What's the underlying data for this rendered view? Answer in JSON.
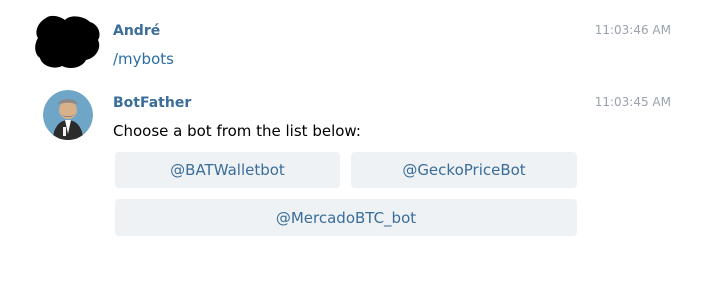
{
  "messages": [
    {
      "sender": "André",
      "time": "11:03:46 AM",
      "text": "/mybots"
    },
    {
      "sender": "BotFather",
      "time": "11:03:45 AM",
      "text": "Choose a bot from the list below:",
      "keyboard": [
        [
          "@BATWalletbot",
          "@GeckoPriceBot"
        ],
        [
          "@MercadoBTC_bot"
        ]
      ]
    }
  ],
  "colors": {
    "sender": "#3a6d99",
    "command": "#2a6ea6",
    "button_bg": "#eef2f5",
    "timestamp": "#9aa3ad"
  }
}
